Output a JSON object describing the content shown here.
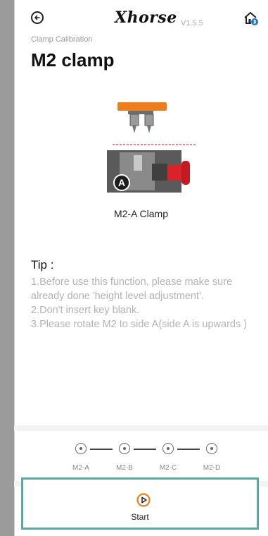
{
  "header": {
    "brand": "Xhorse",
    "version": "V1.5.5"
  },
  "breadcrumb": "Clamp Calibration",
  "page_title": "M2 clamp",
  "illustration": {
    "badge": "A",
    "caption": "M2-A Clamp"
  },
  "tip": {
    "heading": "Tip :",
    "lines": [
      "1.Before use this function, please make sure already done 'height level adjustment'.",
      "2.Don't insert key blank.",
      "3.Please rotate M2 to side A(side A is upwards )"
    ]
  },
  "stepper": {
    "steps": [
      "M2-A",
      "M2-B",
      "M2-C",
      "M2-D"
    ]
  },
  "start_button": {
    "label": "Start"
  },
  "colors": {
    "accent": "#f07c1b",
    "frame_highlight": "#5aa8a6",
    "clamp_red": "#d8232a"
  }
}
